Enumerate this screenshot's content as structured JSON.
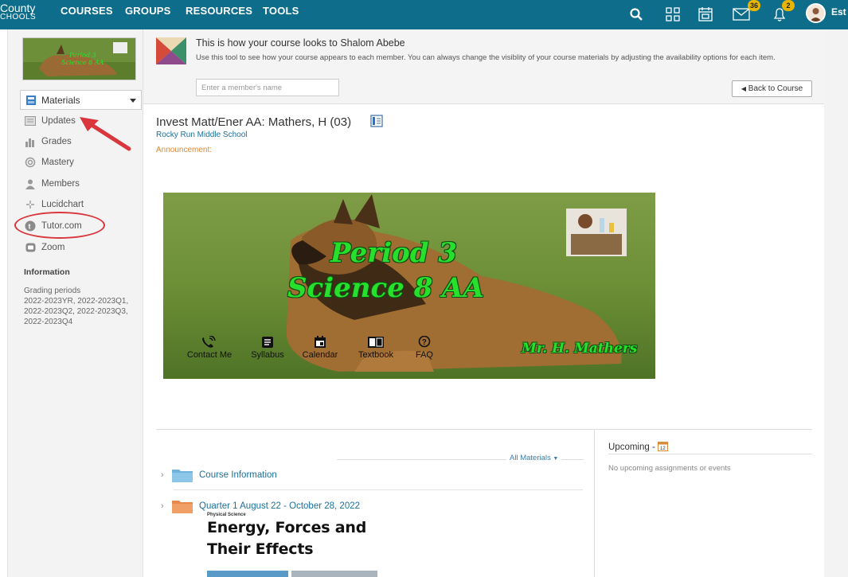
{
  "topbar": {
    "logo_line1": "County",
    "logo_line2": "CHOOLS",
    "nav": [
      "COURSES",
      "GROUPS",
      "RESOURCES",
      "TOOLS"
    ],
    "messages_count": "36",
    "notifications_count": "2",
    "user_name": "Est",
    "bar_color": "#0e6d8a"
  },
  "sidebar": {
    "dropdown_label": "Materials",
    "items": [
      {
        "label": "Updates",
        "icon": "updates-icon"
      },
      {
        "label": "Grades",
        "icon": "grades-icon"
      },
      {
        "label": "Mastery",
        "icon": "mastery-icon"
      },
      {
        "label": "Members",
        "icon": "members-icon"
      },
      {
        "label": "Lucidchart",
        "icon": "lucidchart-icon"
      },
      {
        "label": "Tutor.com",
        "icon": "tutor-icon"
      },
      {
        "label": "Zoom",
        "icon": "zoom-icon"
      }
    ],
    "info_heading": "Information",
    "grading_label": "Grading periods",
    "grading_lines": [
      "2022-2023YR, 2022-2023Q1,",
      "2022-2023Q2, 2022-2023Q3,",
      "2022-2023Q4"
    ]
  },
  "banner": {
    "title": "This is how your course looks to Shalom Abebe",
    "description": "Use this tool to see how your course appears to each member. You can always change the visiblity of your course materials by adjusting the availability options for each item.",
    "input_placeholder": "Enter a member's name",
    "back_button": "Back to Course"
  },
  "course": {
    "title": "Invest Matt/Ener AA: Mathers, H (03)",
    "school": "Rocky Run Middle School",
    "announcement_label": "Announcement:"
  },
  "hero": {
    "line1": "Period 3",
    "line2": "Science 8 AA",
    "signature": "Mr. H. Mathers",
    "menu": [
      "Contact Me",
      "Syllabus",
      "Calendar",
      "Textbook",
      "FAQ"
    ],
    "text_color": "#27e02b"
  },
  "upcoming": {
    "title": "Upcoming -",
    "empty_text": "No upcoming assignments or events"
  },
  "materials": {
    "filter_label": "All Materials",
    "folders": [
      {
        "label": "Course Information",
        "color": "#6fb3dd"
      },
      {
        "label": "Quarter 1 August 22 - October 28, 2022",
        "color": "#e8884a"
      }
    ],
    "preview_small": "Physical Science",
    "preview_line1": "Energy, Forces and",
    "preview_line2": "Their Effects"
  }
}
